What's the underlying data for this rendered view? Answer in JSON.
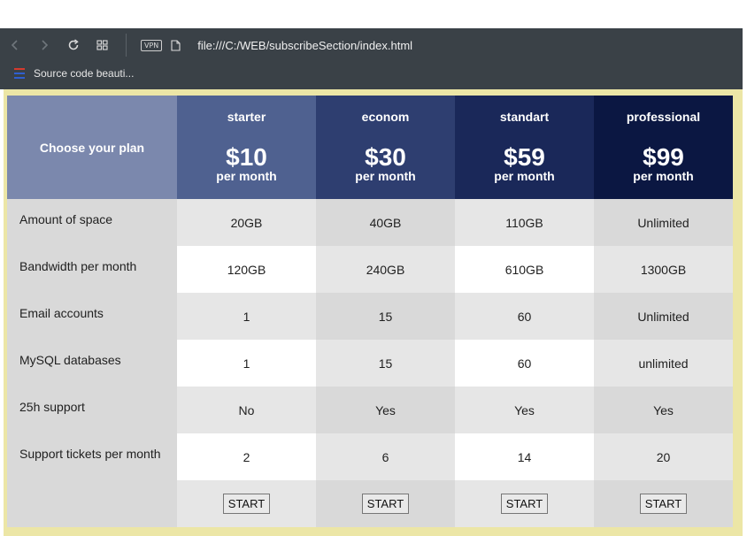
{
  "browser": {
    "url": "file:///C:/WEB/subscribeSection/index.html",
    "vpn_label": "VPN",
    "bookmark_label": "Source code beauti...",
    "back_icon": "back-arrow-icon",
    "forward_icon": "forward-arrow-icon",
    "reload_icon": "reload-icon",
    "grid_icon": "speed-dial-icon"
  },
  "pricing": {
    "header_label": "Choose your plan",
    "plans": [
      {
        "name": "starter",
        "price": "$10",
        "period": "per month"
      },
      {
        "name": "econom",
        "price": "$30",
        "period": "per month"
      },
      {
        "name": "standart",
        "price": "$59",
        "period": "per month"
      },
      {
        "name": "professional",
        "price": "$99",
        "period": "per month"
      }
    ],
    "features": [
      {
        "label": "Amount of space",
        "values": [
          "20GB",
          "40GB",
          "110GB",
          "Unlimited"
        ]
      },
      {
        "label": "Bandwidth per month",
        "values": [
          "120GB",
          "240GB",
          "610GB",
          "1300GB"
        ]
      },
      {
        "label": "Email accounts",
        "values": [
          "1",
          "15",
          "60",
          "Unlimited"
        ]
      },
      {
        "label": "MySQL databases",
        "values": [
          "1",
          "15",
          "60",
          "unlimited"
        ]
      },
      {
        "label": "25h support",
        "values": [
          "No",
          "Yes",
          "Yes",
          "Yes"
        ]
      },
      {
        "label": "Support tickets per month",
        "values": [
          "2",
          "6",
          "14",
          "20"
        ]
      }
    ],
    "button_label": "START"
  },
  "colors": {
    "header_label_bg": "#7b88ad",
    "plan_bgs": [
      "#4f6190",
      "#2e3e70",
      "#1a2859",
      "#0b1742"
    ],
    "page_bg": "#ece6a6",
    "toolbar_bg": "#3a4147"
  }
}
